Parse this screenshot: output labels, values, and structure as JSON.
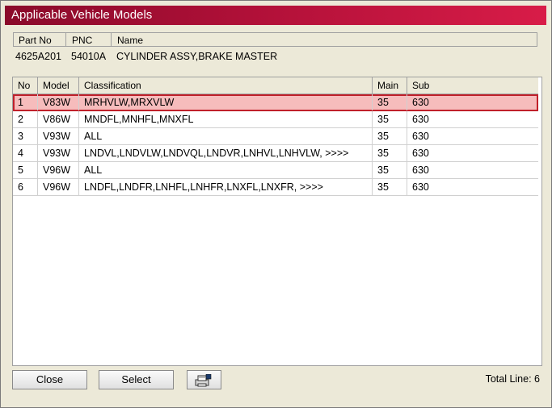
{
  "window": {
    "title": "Applicable Vehicle Models"
  },
  "part_header": {
    "part_no_label": "Part No",
    "pnc_label": "PNC",
    "name_label": "Name"
  },
  "part": {
    "part_no": "4625A201",
    "pnc": "54010A",
    "name": "CYLINDER ASSY,BRAKE MASTER"
  },
  "table": {
    "columns": [
      "No",
      "Model",
      "Classification",
      "Main",
      "Sub"
    ],
    "rows": [
      {
        "no": "1",
        "model": "V83W",
        "classification": "MRHVLW,MRXVLW",
        "main": "35",
        "sub": "630",
        "selected": true
      },
      {
        "no": "2",
        "model": "V86W",
        "classification": "MNDFL,MNHFL,MNXFL",
        "main": "35",
        "sub": "630"
      },
      {
        "no": "3",
        "model": "V93W",
        "classification": "ALL",
        "main": "35",
        "sub": "630"
      },
      {
        "no": "4",
        "model": "V93W",
        "classification": "LNDVL,LNDVLW,LNDVQL,LNDVR,LNHVL,LNHVLW,  >>>>",
        "main": "35",
        "sub": "630"
      },
      {
        "no": "5",
        "model": "V96W",
        "classification": "ALL",
        "main": "35",
        "sub": "630"
      },
      {
        "no": "6",
        "model": "V96W",
        "classification": "LNDFL,LNDFR,LNHFL,LNHFR,LNXFL,LNXFR,  >>>>",
        "main": "35",
        "sub": "630"
      }
    ]
  },
  "buttons": {
    "close": "Close",
    "select": "Select",
    "print_icon": "printer-icon"
  },
  "footer": {
    "total_line": "Total Line: 6"
  },
  "colors": {
    "title_dark": "#8a0a2a",
    "title_light": "#d81c48",
    "selected_row": "#f6bcbc",
    "selected_border": "#c0202a"
  }
}
